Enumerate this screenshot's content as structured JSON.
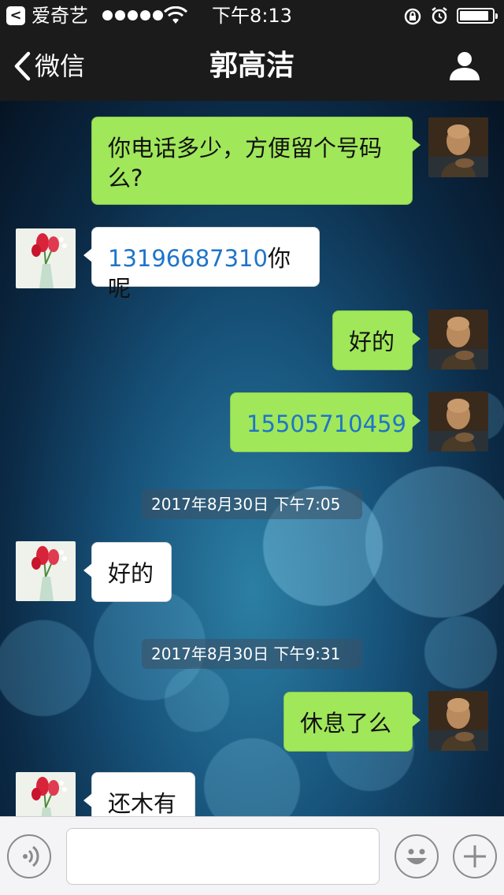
{
  "status_bar": {
    "back_app_glyph": "<",
    "app_name": "爱奇艺",
    "signal_dots": 5,
    "time": "下午8:13",
    "battery_level": 0.9,
    "icons": [
      "back-app-icon",
      "signal-icon",
      "wifi-icon",
      "rotation-lock-icon",
      "alarm-icon",
      "battery-icon"
    ]
  },
  "nav": {
    "back_label": "微信",
    "title": "郭高洁",
    "back_icon": "chevron-left-icon",
    "profile_icon": "person-icon"
  },
  "colors": {
    "my_bubble": "#a0e75a",
    "their_bubble": "#ffffff",
    "link": "#1f74c9",
    "bar": "#1b1b1b"
  },
  "messages": [
    {
      "from": "me",
      "text": "你电话多少，方便留个号码么?"
    },
    {
      "from": "them",
      "link": "13196687310",
      "text": "你呢"
    },
    {
      "from": "me",
      "text": "好的"
    },
    {
      "from": "me",
      "link": "15505710459"
    },
    {
      "type": "timestamp",
      "text": "2017年8月30日 下午7:05"
    },
    {
      "from": "them",
      "text": "好的"
    },
    {
      "type": "timestamp",
      "text": "2017年8月30日 下午9:31"
    },
    {
      "from": "me",
      "text": "休息了么"
    },
    {
      "from": "them",
      "text": "还木有"
    }
  ],
  "input_bar": {
    "voice_icon": "voice-icon",
    "emoji_icon": "emoji-icon",
    "plus_icon": "plus-icon",
    "input_value": "",
    "input_placeholder": ""
  }
}
